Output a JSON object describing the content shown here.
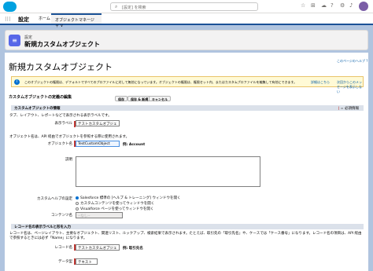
{
  "topbar": {
    "search_placeholder": "[設定] を検索",
    "search_icon": "search-icon",
    "utility_icons": [
      "star-icon",
      "add-icon",
      "cloud-icon",
      "help-icon",
      "gear-icon",
      "bell-icon"
    ]
  },
  "navbar": {
    "app_name": "設定",
    "tabs": [
      {
        "label": "ホーム"
      },
      {
        "label": "オブジェクトマネージャ ∨"
      }
    ]
  },
  "header": {
    "breadcrumb": "設定",
    "title": "新規カスタムオブジェクト"
  },
  "page": {
    "title": "新規カスタムオブジェクト",
    "help_link": "このページのヘルプ ?",
    "info_text": "このオブジェクトの権限は、デフォルトですべてのプロファイルに対して無効になっています。オブジェクトの権限は、権限セット内、またはカスタムプロファイルを編集して有効にできます。",
    "info_link_1": "詳細はこちら",
    "info_link_2": "次回からこのメッセージを表示しない",
    "edit_heading": "カスタムオブジェクトの定義の編集",
    "buttons": {
      "save": "保存",
      "save_new": "保存 & 新規",
      "cancel": "キャンセル"
    },
    "section1": {
      "title": "カスタムオブジェクトの情報",
      "required": "= 必須情報"
    },
    "desc_tab": "タブ、レイアウト、レポートなどで表示される表示ラベルです。",
    "label_field": {
      "label": "表示ラベル",
      "value": "テストカスタムオブジェ"
    },
    "desc_api": "オブジェクト名は、API 経由でオブジェクトを参照する際に使用されます。",
    "name_field": {
      "label": "オブジェクト名",
      "value": "TestCustomObject",
      "example": "例: Account"
    },
    "description_label": "説明",
    "help_setting": {
      "label": "カスタムヘルプの設定",
      "options": [
        "Salesforce 標準の [ヘルプ & トレーニング] ウィンドウを開く",
        "カスタムコンテンツを使ってウィンドウを開く",
        "Visualforce ページを使ってウィンドウを開く"
      ]
    },
    "content_name_label": "コンテンツ名",
    "content_name_value": "--なし--",
    "section2": {
      "title": "レコード名の表示ラベルと形を入力"
    },
    "record_desc": "レコード名は、ページレイアウト、主要なオブジェクト、関連リスト、ルックアップ、検索結果で表示されます。たとえば、取引先の「取引先名」や、ケースでは「ケース番号」になります。レコード名の項目は、API 経由で参照するときには必ず「Name」になります。",
    "record_name_field": {
      "label": "レコード名",
      "value": "テストカスタムオブジェ",
      "example": "例: 取引先名"
    },
    "data_type_field": {
      "label": "データ型",
      "value": "テキスト"
    }
  }
}
